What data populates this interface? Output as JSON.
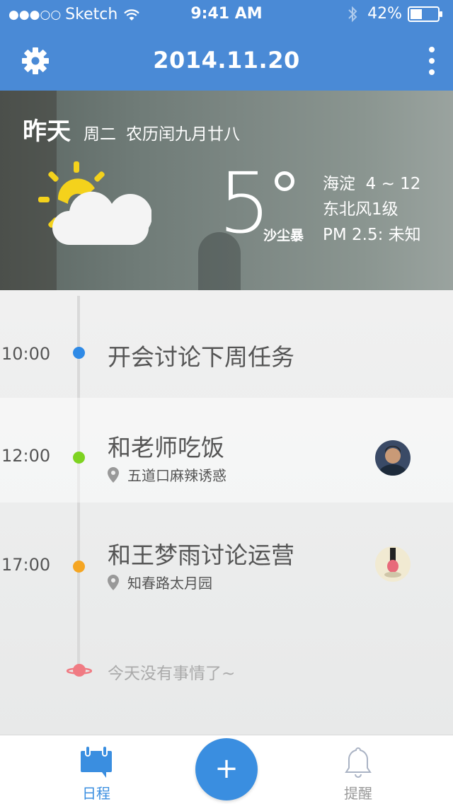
{
  "status_bar": {
    "carrier": "Sketch",
    "time": "9:41 AM",
    "battery": "42%",
    "battery_level": 0.42
  },
  "nav": {
    "title": "2014.11.20"
  },
  "weather": {
    "day": "昨天",
    "weekday": "周二",
    "lunar": "农历闰九月廿八",
    "temperature": "5",
    "condition": "沙尘暴",
    "location_range": "海淀  4 ~ 12",
    "wind": "东北风1级",
    "pm25": "PM 2.5: 未知",
    "icon": "partly-cloudy-icon"
  },
  "schedule": [
    {
      "time": "10:00",
      "title": "开会讨论下周任务",
      "location": "",
      "dot_color": "#2f8ae6"
    },
    {
      "time": "12:00",
      "title": "和老师吃饭",
      "location": "五道口麻辣诱惑",
      "dot_color": "#7ed321"
    },
    {
      "time": "17:00",
      "title": "和王梦雨讨论运营",
      "location": "知春路太月园",
      "dot_color": "#f5a623"
    }
  ],
  "empty_message": "今天没有事情了~",
  "tabbar": {
    "schedule_label": "日程",
    "add_label": "+",
    "remind_label": "提醒"
  },
  "colors": {
    "header_blue": "#4a8ad6",
    "accent_blue": "#3a8ee0",
    "empty_planet": "#f07b83"
  }
}
